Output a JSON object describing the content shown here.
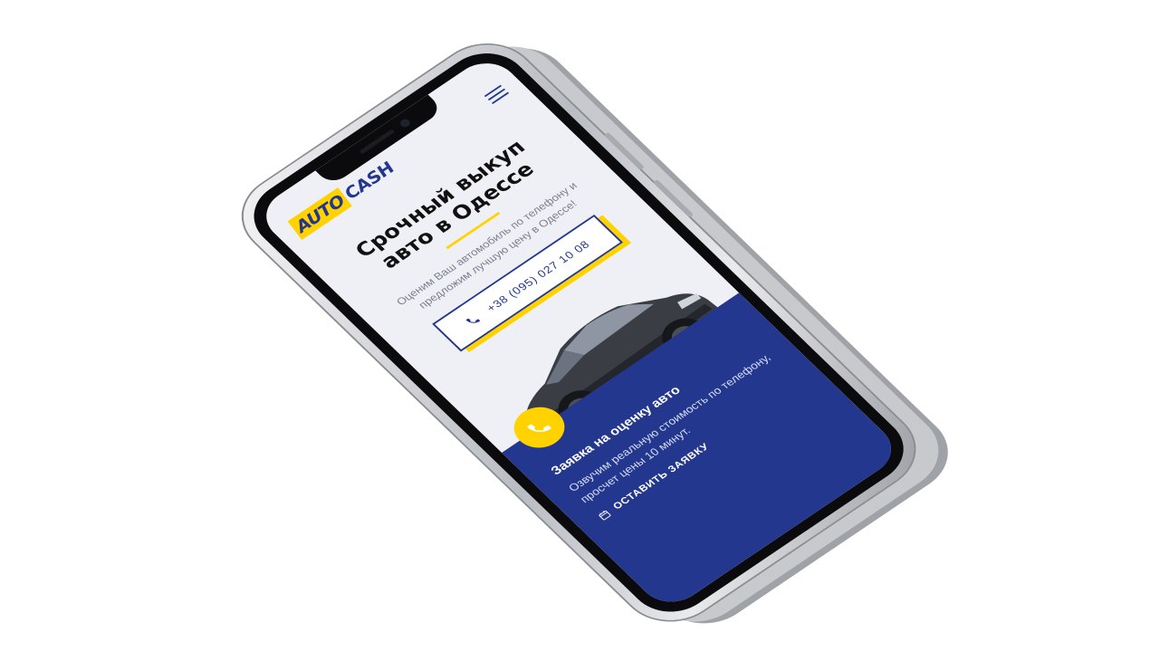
{
  "brand": {
    "logo_part1": "AUTO",
    "logo_part2": "CASH",
    "accent": "#ffd200",
    "primary": "#23378f"
  },
  "hero": {
    "title": "Срочный выкуп авто в Одессе",
    "subtitle": "Оценим Ваш автомобиль по телефону и предложим лучшую цену в Одессе!",
    "phone": "+38 (095) 027 10 08"
  },
  "lead": {
    "title": "Заявка на оценку авто",
    "text": "Озвучим реальную стоимость по телефону, просчет цены 10 минут.",
    "link": "ОСТАВИТЬ ЗАЯВКУ"
  },
  "icons": {
    "menu": "hamburger-menu-icon",
    "phone": "phone-handset-icon",
    "calendar": "calendar-icon"
  }
}
